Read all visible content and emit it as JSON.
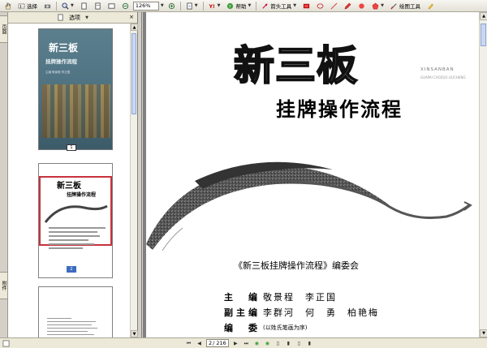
{
  "toolbar": {
    "select_label": "选择",
    "zoom_value": "126%",
    "help_label": "帮助",
    "arrow_tool_label": "箭头工具",
    "markup_tool_label": "绘图工具"
  },
  "thumbnails": {
    "panel_title": "选项",
    "cover": {
      "title": "新三板",
      "subtitle": "挂牌操作流程",
      "meta": "主编 敬景程 李正国",
      "page_number": "1"
    },
    "title_page": {
      "title": "新三板",
      "subtitle": "挂牌操作流程",
      "page_number": "2"
    }
  },
  "left_tabs": {
    "pages_label": "页面",
    "attachments_label": "附件"
  },
  "document": {
    "title": "新三板",
    "subtitle": "挂牌操作流程",
    "latin_line1": "XINSANBAN",
    "latin_line2": "GUAPAI CAOZUO LIUCHENG",
    "committee": "《新三板挂牌操作流程》编委会",
    "roles": [
      {
        "label": "主　编",
        "names": "敬景程　李正国",
        "note": ""
      },
      {
        "label": "副主编",
        "names": "李群河　何　勇　柏艳梅",
        "note": ""
      },
      {
        "label": "编　委",
        "names": "",
        "note": "(以姓氏笔画为序)"
      }
    ]
  },
  "statusbar": {
    "current_page": "2",
    "total_pages": "/ 216"
  },
  "colors": {
    "accent_selection": "#c8323c",
    "cover_bg": "#4d7180",
    "scroll_thumb": "#c9d7f1"
  }
}
